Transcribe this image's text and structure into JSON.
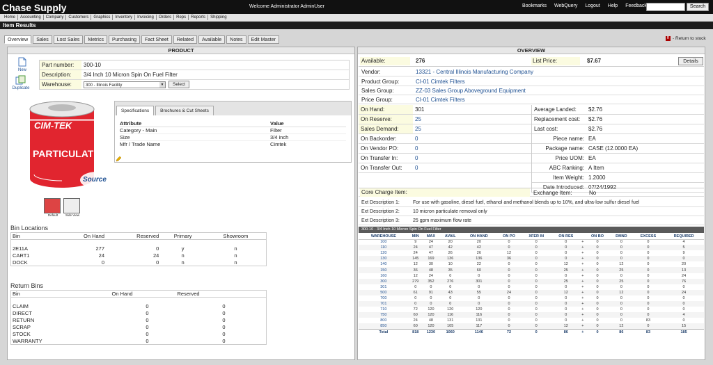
{
  "app": {
    "title": "Chase Supply",
    "welcome": "Welcome Administrator AdminUser"
  },
  "toplinks": [
    "Bookmarks",
    "WebQuery",
    "Logout",
    "Help",
    "Feedback"
  ],
  "search": {
    "button": "Search",
    "value": ""
  },
  "nav": [
    "Home",
    "Accounting",
    "Company",
    "Customers",
    "Graphics",
    "Inventory",
    "Invoicing",
    "Orders",
    "Reps",
    "Reports",
    "Shipping"
  ],
  "page_title": "Item Results",
  "tabs": [
    "Overview",
    "Sales",
    "Lost Sales",
    "Metrics",
    "Purchasing",
    "Fact Sheet",
    "Related",
    "Available",
    "Notes",
    "Edit Master"
  ],
  "return_link": "- Return to stock",
  "product": {
    "heading": "PRODUCT",
    "new_label": "New",
    "duplicate_label": "Duplicate",
    "part_number_label": "Part number:",
    "part_number": "300-10",
    "description_label": "Description:",
    "description": "3/4 Inch 10 Micron Spin On Fuel Filter",
    "warehouse_label": "Warehouse:",
    "warehouse_value": "300 - Illinois Facility",
    "select_button": "Select",
    "image_default": "Default",
    "image_side": "Side View",
    "brand_text": "CIM-TEK",
    "particulate_text": "PARTICULATE",
    "source_text": "Source",
    "spec_tabs": [
      "Specifications",
      "Brochures & Cut Sheets"
    ],
    "spec_headers": [
      "Attribute",
      "Value"
    ],
    "specs": [
      {
        "attr": "Category - Main",
        "value": "Filter"
      },
      {
        "attr": "Size",
        "value": "3/4 inch"
      },
      {
        "attr": "Mfr / Trade Name",
        "value": "Cimtek"
      }
    ]
  },
  "bin_locations": {
    "title": "Bin Locations",
    "headers": [
      "Bin",
      "On Hand",
      "Reserved",
      "Primary",
      "Showroom"
    ],
    "rows": [
      {
        "bin": "2E11A",
        "on_hand": "277",
        "reserved": "0",
        "primary": "y",
        "showroom": "n"
      },
      {
        "bin": "CART1",
        "on_hand": "24",
        "reserved": "24",
        "primary": "n",
        "showroom": "n"
      },
      {
        "bin": "DOCK",
        "on_hand": "0",
        "reserved": "0",
        "primary": "n",
        "showroom": "n"
      }
    ]
  },
  "return_bins": {
    "title": "Return Bins",
    "headers": [
      "Bin",
      "On Hand",
      "Reserved"
    ],
    "rows": [
      {
        "bin": "CLAIM",
        "on_hand": "0",
        "reserved": "0"
      },
      {
        "bin": "DIRECT",
        "on_hand": "0",
        "reserved": "0"
      },
      {
        "bin": "RETURN",
        "on_hand": "0",
        "reserved": "0"
      },
      {
        "bin": "SCRAP",
        "on_hand": "0",
        "reserved": "0"
      },
      {
        "bin": "STOCK",
        "on_hand": "0",
        "reserved": "0"
      },
      {
        "bin": "WARRANTY",
        "on_hand": "0",
        "reserved": "0"
      }
    ]
  },
  "overview": {
    "heading": "OVERVIEW",
    "available_label": "Available:",
    "available": "276",
    "list_price_label": "List Price:",
    "list_price": "$7.67",
    "details_button": "Details",
    "vendor_label": "Vendor:",
    "vendor": "13321 - Central Illinois Manufacturing Company",
    "product_group_label": "Product Group:",
    "product_group": "CI-01 Cimtek Filters",
    "sales_group_label": "Sales Group:",
    "sales_group": "ZZ-03 Sales Group Aboveground Equipment",
    "price_group_label": "Price Group:",
    "price_group": "CI-01 Cimtek Filters",
    "left": [
      {
        "label": "On Hand:",
        "value": "301"
      },
      {
        "label": "On Reserve:",
        "value": "25"
      },
      {
        "label": "Sales Demand:",
        "value": "25"
      },
      {
        "label": "On Backorder:",
        "value": "0"
      },
      {
        "label": "On Vendor PO:",
        "value": "0"
      },
      {
        "label": "On Transfer In:",
        "value": "0"
      },
      {
        "label": "On Transfer Out:",
        "value": "0"
      }
    ],
    "right": [
      {
        "label": "Average Landed:",
        "value": "$2.76"
      },
      {
        "label": "Replacement cost:",
        "value": "$2.76"
      },
      {
        "label": "Last cost:",
        "value": "$2.76"
      },
      {
        "label": "Piece name:",
        "value": "EA"
      },
      {
        "label": "Package name:",
        "value": "CASE (12.0000 EA)"
      },
      {
        "label": "Price UOM:",
        "value": "EA"
      },
      {
        "label": "ABC Ranking:",
        "value": "A Item"
      },
      {
        "label": "Item Weight:",
        "value": "1.2000"
      },
      {
        "label": "Date Introduced:",
        "value": "07/24/1992"
      }
    ],
    "core_charge_label": "Core Charge Item:",
    "exchange_label": "Exchange Item:",
    "exchange_value": "No",
    "ext": [
      {
        "label": "Ext Description 1:",
        "value": "For use with gasoline, diesel fuel, ethanol and methanol blends up to 10%, and ultra-low sulfur diesel fuel"
      },
      {
        "label": "Ext Description 2:",
        "value": "10 micron particulate removal only"
      },
      {
        "label": "Ext Description 3:",
        "value": "25 gpm maximum flow rate"
      }
    ],
    "table_title": "300-10 - 3/4 Inch 10 Micron Spin On Fuel Filter"
  },
  "warehouse_table": {
    "headers": [
      "WAREHOUSE",
      "MIN",
      "MAX",
      "AVAIL",
      "ON HAND",
      "ON PO",
      "XFER IN",
      "ON RES",
      "",
      "ON BO",
      "DMND",
      "EXCESS",
      "REQUIRED"
    ],
    "rows": [
      [
        "100",
        "9",
        "24",
        "20",
        "20",
        "0",
        "0",
        "0",
        "+",
        "0",
        "0",
        "0",
        "4"
      ],
      [
        "110",
        "24",
        "47",
        "42",
        "42",
        "0",
        "0",
        "0",
        "+",
        "0",
        "0",
        "0",
        "5"
      ],
      [
        "120",
        "24",
        "47",
        "26",
        "26",
        "12",
        "0",
        "0",
        "+",
        "0",
        "0",
        "0",
        "9"
      ],
      [
        "130",
        "145",
        "169",
        "136",
        "136",
        "36",
        "0",
        "0",
        "+",
        "0",
        "0",
        "0",
        "0"
      ],
      [
        "140",
        "12",
        "30",
        "10",
        "22",
        "0",
        "0",
        "12",
        "+",
        "0",
        "12",
        "0",
        "20"
      ],
      [
        "150",
        "36",
        "48",
        "35",
        "60",
        "0",
        "0",
        "25",
        "+",
        "0",
        "25",
        "0",
        "13"
      ],
      [
        "160",
        "12",
        "24",
        "0",
        "0",
        "0",
        "0",
        "0",
        "+",
        "0",
        "0",
        "0",
        "24"
      ],
      [
        "300",
        "279",
        "352",
        "276",
        "301",
        "0",
        "0",
        "25",
        "+",
        "0",
        "25",
        "0",
        "76"
      ],
      [
        "301",
        "0",
        "0",
        "0",
        "0",
        "0",
        "0",
        "0",
        "+",
        "0",
        "0",
        "0",
        "0"
      ],
      [
        "500",
        "61",
        "91",
        "43",
        "55",
        "24",
        "0",
        "12",
        "+",
        "0",
        "12",
        "0",
        "24"
      ],
      [
        "700",
        "0",
        "0",
        "0",
        "0",
        "0",
        "0",
        "0",
        "+",
        "0",
        "0",
        "0",
        "0"
      ],
      [
        "701",
        "0",
        "0",
        "0",
        "0",
        "0",
        "0",
        "0",
        "+",
        "0",
        "0",
        "0",
        "0"
      ],
      [
        "710",
        "72",
        "120",
        "120",
        "120",
        "0",
        "0",
        "0",
        "+",
        "0",
        "0",
        "0",
        "0"
      ],
      [
        "750",
        "60",
        "120",
        "116",
        "116",
        "0",
        "0",
        "0",
        "+",
        "0",
        "0",
        "0",
        "4"
      ],
      [
        "800",
        "24",
        "48",
        "131",
        "131",
        "0",
        "0",
        "0",
        "+",
        "0",
        "0",
        "83",
        "0"
      ],
      [
        "850",
        "60",
        "120",
        "105",
        "117",
        "0",
        "0",
        "12",
        "+",
        "0",
        "12",
        "0",
        "15"
      ]
    ],
    "total": [
      "Total",
      "818",
      "1230",
      "1060",
      "1146",
      "72",
      "0",
      "86",
      "+",
      "0",
      "86",
      "83",
      "185"
    ]
  },
  "colors": {
    "topbar": "#111111",
    "label_bg": "#fbfbe0",
    "link": "#1d4f91",
    "filter_red": "#e1252f"
  }
}
